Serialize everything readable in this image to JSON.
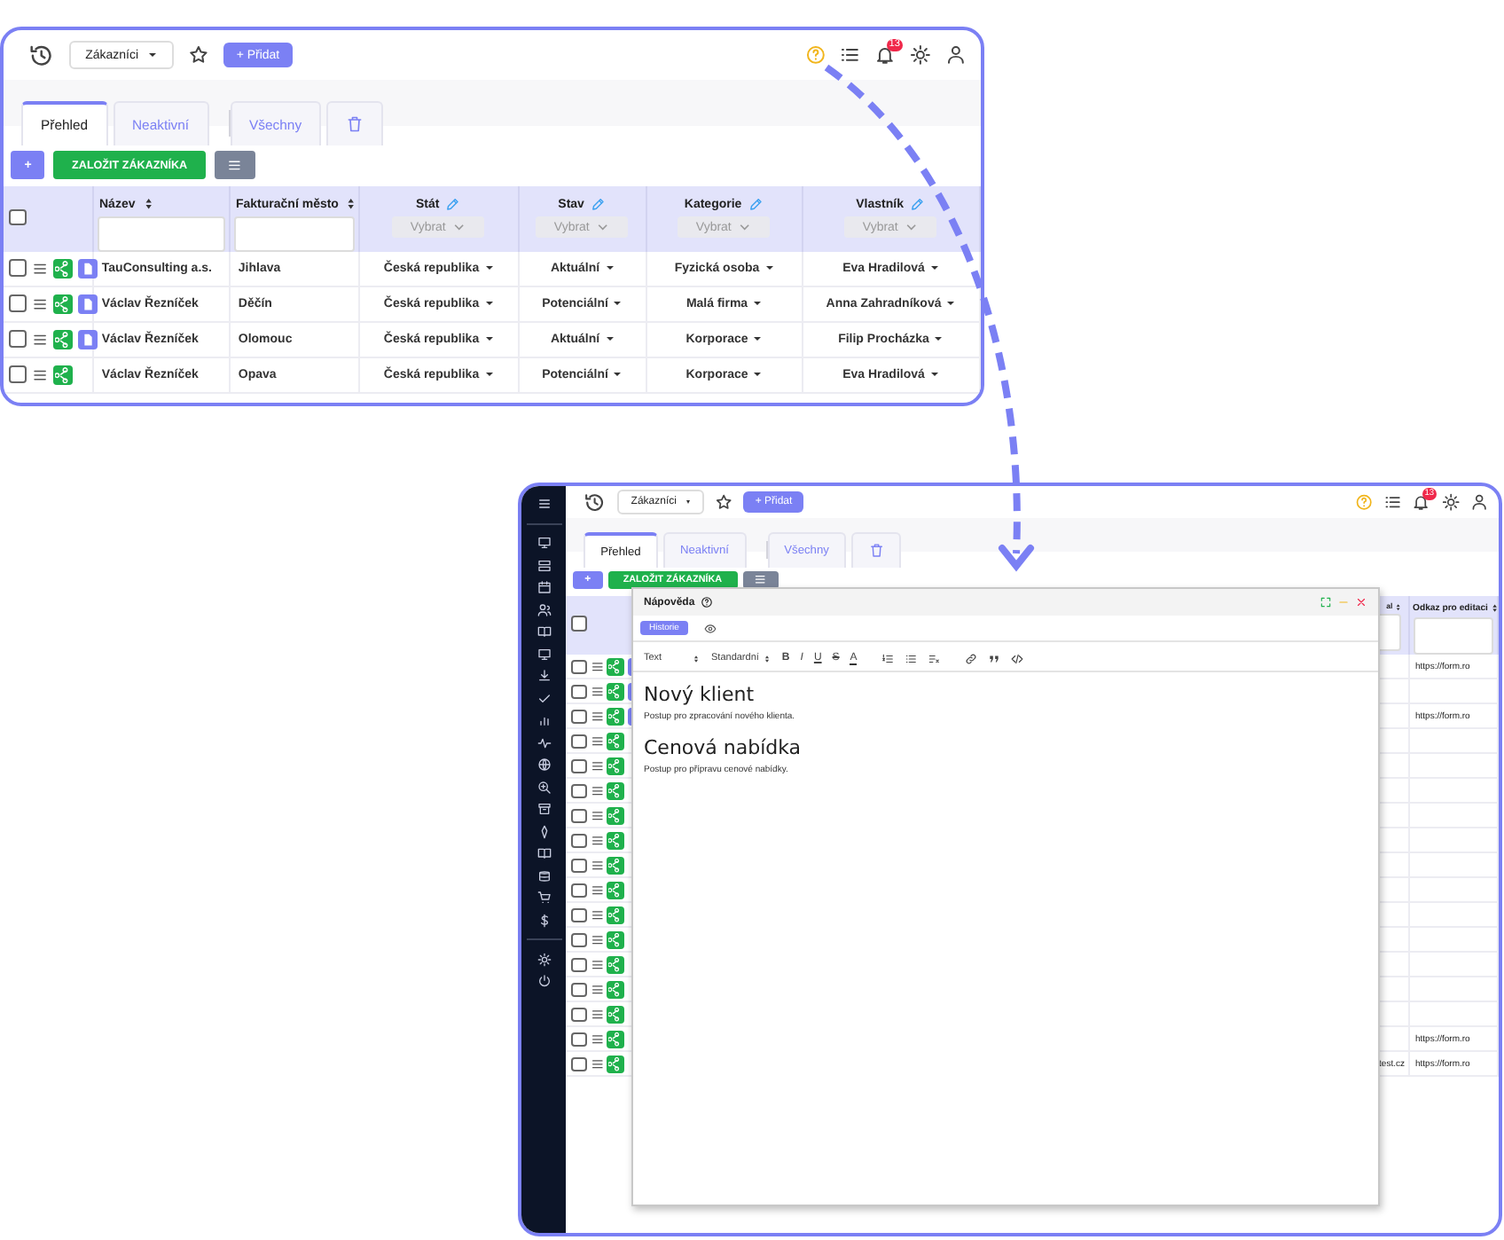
{
  "overview": {
    "header": {
      "module": "Zákazníci",
      "add": "+ Přidat",
      "badge": "13"
    },
    "tabs": [
      {
        "kind": "text",
        "label": "Přehled",
        "selected": true,
        "group_start": false
      },
      {
        "kind": "text",
        "label": "Neaktivní",
        "selected": false,
        "group_start": false
      },
      {
        "kind": "text",
        "label": "Všechny",
        "selected": false,
        "group_start": true
      },
      {
        "kind": "trash",
        "selected": false,
        "group_start": false
      }
    ],
    "toolbar": {
      "add": "+",
      "create": "ZALOŽIT ZÁKAZNÍKA"
    },
    "table": {
      "all_checked": false,
      "columns": [
        {
          "label": "Název",
          "kind": "text"
        },
        {
          "label": "Fakturační město",
          "kind": "text"
        },
        {
          "label": "Stát",
          "kind": "select",
          "placeholder": "Vybrat"
        },
        {
          "label": "Stav",
          "kind": "select",
          "placeholder": "Vybrat"
        },
        {
          "label": "Kategorie",
          "kind": "select",
          "placeholder": "Vybrat"
        },
        {
          "label": "Vlastník",
          "kind": "select",
          "placeholder": "Vybrat"
        }
      ],
      "rows": [
        {
          "checked": false,
          "doc": true,
          "cells": [
            "TauConsulting a.s.",
            "Jihlava",
            "Česká republika",
            "Aktuální",
            "Fyzická osoba",
            "Eva Hradilová"
          ]
        },
        {
          "checked": false,
          "doc": true,
          "cells": [
            "Václav Řezníček",
            "Děčín",
            "Česká republika",
            "Potenciální",
            "Malá firma",
            "Anna Zahradníková"
          ]
        },
        {
          "checked": false,
          "doc": true,
          "cells": [
            "Václav Řezníček",
            "Olomouc",
            "Česká republika",
            "Aktuální",
            "Korporace",
            "Filip Procházka"
          ]
        },
        {
          "checked": false,
          "doc": false,
          "cells": [
            "Václav Řezníček",
            "Opava",
            "Česká republika",
            "Potenciální",
            "Korporace",
            "Eva Hradilová"
          ]
        }
      ]
    }
  },
  "help_view": {
    "header": {
      "module": "Zákazníci",
      "add": "+ Přidat",
      "badge": "13"
    },
    "tabs": [
      {
        "kind": "text",
        "label": "Přehled",
        "selected": true,
        "group_start": false
      },
      {
        "kind": "text",
        "label": "Neaktivní",
        "selected": false,
        "group_start": false
      },
      {
        "kind": "text",
        "label": "Všechny",
        "selected": false,
        "group_start": true
      },
      {
        "kind": "trash",
        "selected": false,
        "group_start": false
      }
    ],
    "toolbar": {
      "add": "+",
      "create": "ZALOŽIT ZÁKAZNÍKA"
    },
    "table": {
      "all_checked": false,
      "column_a": "al",
      "column_b": "Odkaz pro editaci",
      "rows": [
        {
          "checked": false,
          "doc": true,
          "column_b": "https://form.ro"
        },
        {
          "checked": false,
          "doc": true
        },
        {
          "checked": false,
          "doc": true,
          "column_b": "https://form.ro"
        },
        {
          "checked": false,
          "doc": false
        },
        {
          "checked": false,
          "doc": false
        },
        {
          "checked": false,
          "doc": false
        },
        {
          "checked": false,
          "doc": false
        },
        {
          "checked": false,
          "doc": false
        },
        {
          "checked": false,
          "doc": false
        },
        {
          "checked": false,
          "doc": false
        },
        {
          "checked": false,
          "doc": false
        },
        {
          "checked": false,
          "doc": false
        },
        {
          "checked": false,
          "doc": false
        },
        {
          "checked": false,
          "doc": false
        },
        {
          "checked": false,
          "doc": false
        },
        {
          "checked": false,
          "doc": false,
          "column_b": "https://form.ro"
        },
        {
          "checked": false,
          "doc": false,
          "column_a": "test.cz",
          "column_b": "https://form.ro"
        }
      ]
    },
    "help_dialog": {
      "title": "Nápověda",
      "tabs": [
        {
          "kind": "text",
          "label": "Historie",
          "selected": true
        },
        {
          "kind": "eye",
          "selected": false
        }
      ],
      "format": {
        "style": "Text",
        "size": "Standardní",
        "marks": [
          {
            "kind": "bold",
            "label": "B"
          },
          {
            "kind": "italic",
            "label": "I"
          },
          {
            "kind": "underline",
            "label": "U"
          },
          {
            "kind": "strike",
            "label": "S"
          },
          {
            "kind": "color",
            "label": "A"
          }
        ]
      },
      "sections": [
        {
          "heading": "Nový klient",
          "text": "Postup pro zpracování nového klienta."
        },
        {
          "heading": "Cenová nabídka",
          "text": "Postup pro přípravu cenové nabídky."
        }
      ]
    }
  }
}
